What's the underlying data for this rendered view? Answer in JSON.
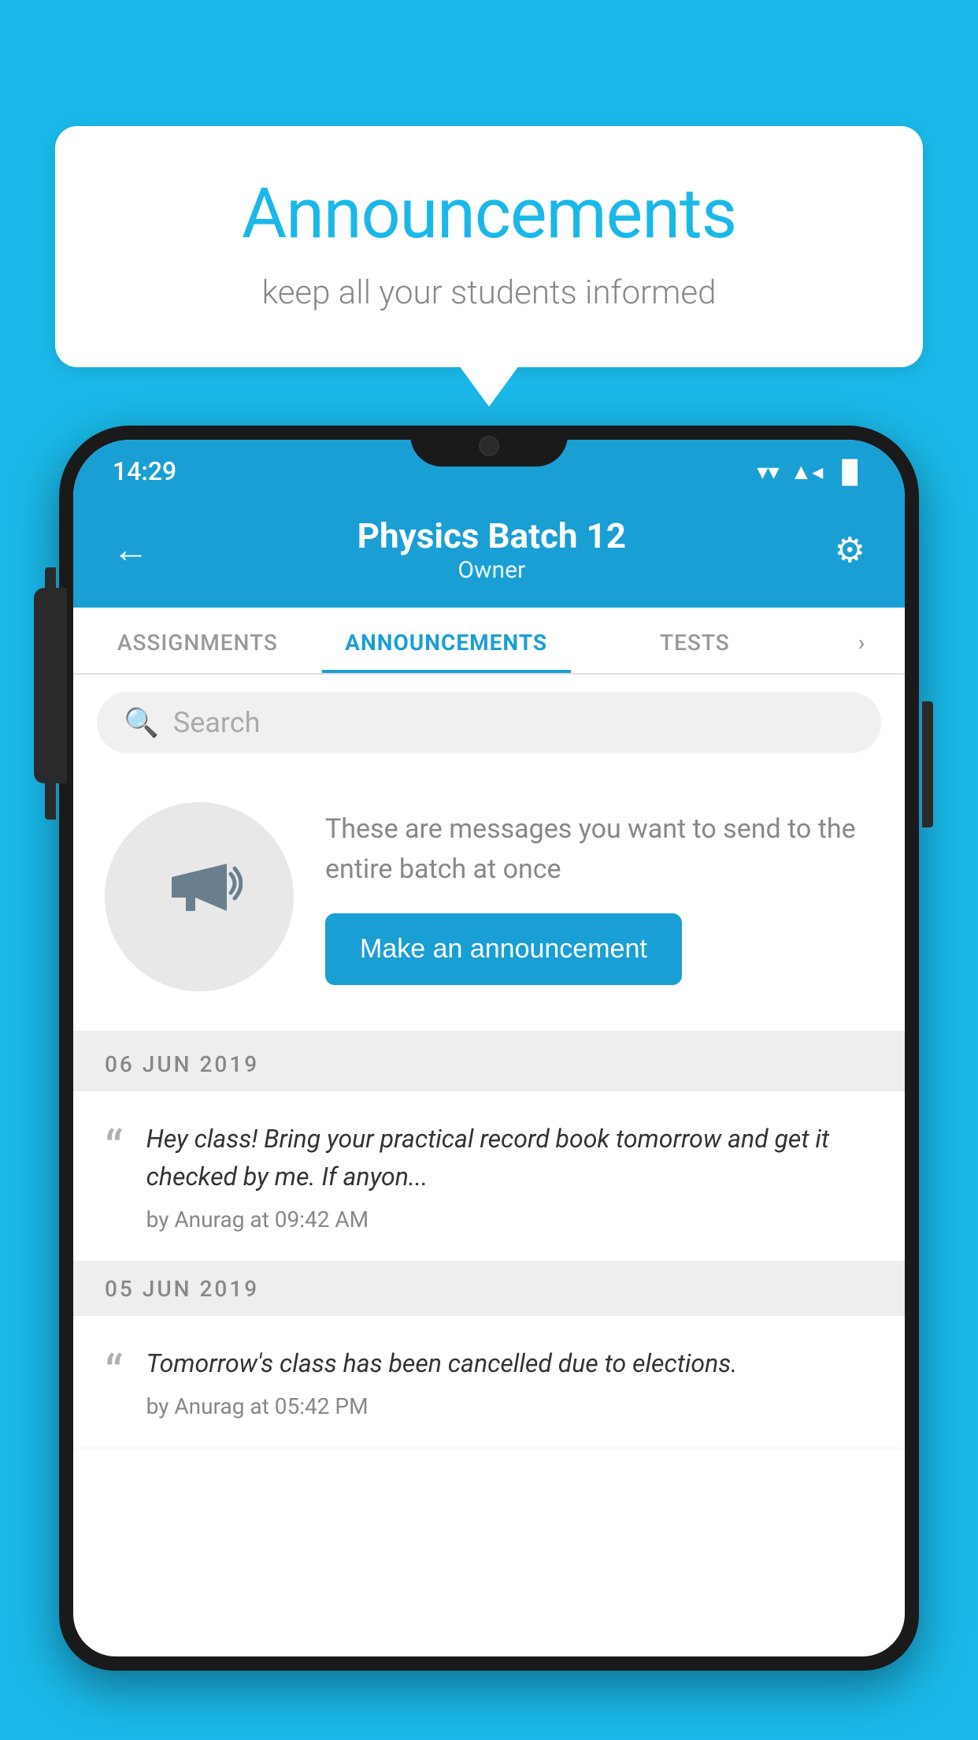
{
  "background_color": "#1ab8e8",
  "speech_bubble": {
    "title": "Announcements",
    "subtitle": "keep all your students informed"
  },
  "phone": {
    "status_bar": {
      "time": "14:29",
      "wifi": "▾",
      "signal": "▲",
      "battery": "▐"
    },
    "header": {
      "back_label": "←",
      "title": "Physics Batch 12",
      "subtitle": "Owner",
      "settings_label": "⚙"
    },
    "tabs": [
      {
        "label": "ASSIGNMENTS",
        "active": false
      },
      {
        "label": "ANNOUNCEMENTS",
        "active": true
      },
      {
        "label": "TESTS",
        "active": false
      },
      {
        "label": "›",
        "active": false
      }
    ],
    "search": {
      "placeholder": "Search"
    },
    "announcement_promo": {
      "description": "These are messages you want to send to the entire batch at once",
      "button_label": "Make an announcement"
    },
    "date_sections": [
      {
        "date": "06  JUN  2019",
        "announcements": [
          {
            "text": "Hey class! Bring your practical record book tomorrow and get it checked by me. If anyon...",
            "author": "by Anurag at 09:42 AM"
          }
        ]
      },
      {
        "date": "05  JUN  2019",
        "announcements": [
          {
            "text": "Tomorrow's class has been cancelled due to elections.",
            "author": "by Anurag at 05:42 PM"
          }
        ]
      }
    ]
  }
}
